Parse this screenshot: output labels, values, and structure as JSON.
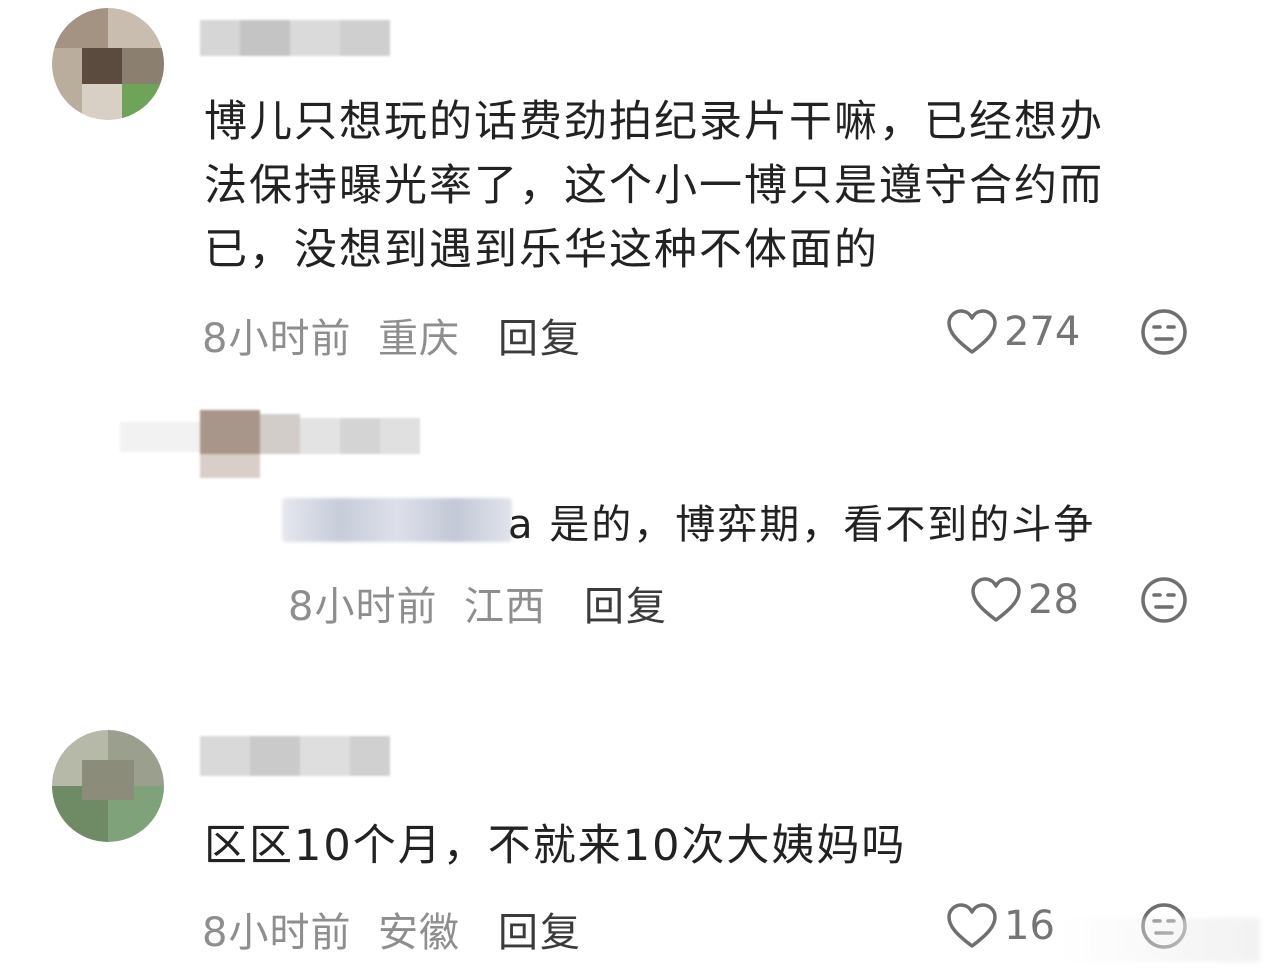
{
  "comments": [
    {
      "text_lines": [
        "博儿只想玩的话费劲拍纪录片干嘛，已经想办",
        "法保持曝光率了，这个小一博只是遵守合约而",
        "已，没想到遇到乐华这种不体面的"
      ],
      "time": "8小时前",
      "location": "重庆",
      "reply_label": "回复",
      "likes": "274",
      "like_icon": "heart-outline-icon",
      "emoji_icon": "neutral-face-icon"
    },
    {
      "reply_text": "a 是的，博弈期，看不到的斗争",
      "time": "8小时前",
      "location": "江西",
      "reply_label": "回复",
      "likes": "28",
      "like_icon": "heart-outline-icon",
      "emoji_icon": "neutral-face-icon"
    },
    {
      "text_lines": [
        "区区10个月，不就来10次大姨妈吗"
      ],
      "time": "8小时前",
      "location": "安徽",
      "reply_label": "回复",
      "likes": "16",
      "like_icon": "heart-outline-icon",
      "emoji_icon": "neutral-face-icon"
    }
  ],
  "colors": {
    "text": "#222222",
    "meta": "#8e8e8e",
    "reply": "#3b3b3b",
    "icon": "#6f6f6f"
  }
}
